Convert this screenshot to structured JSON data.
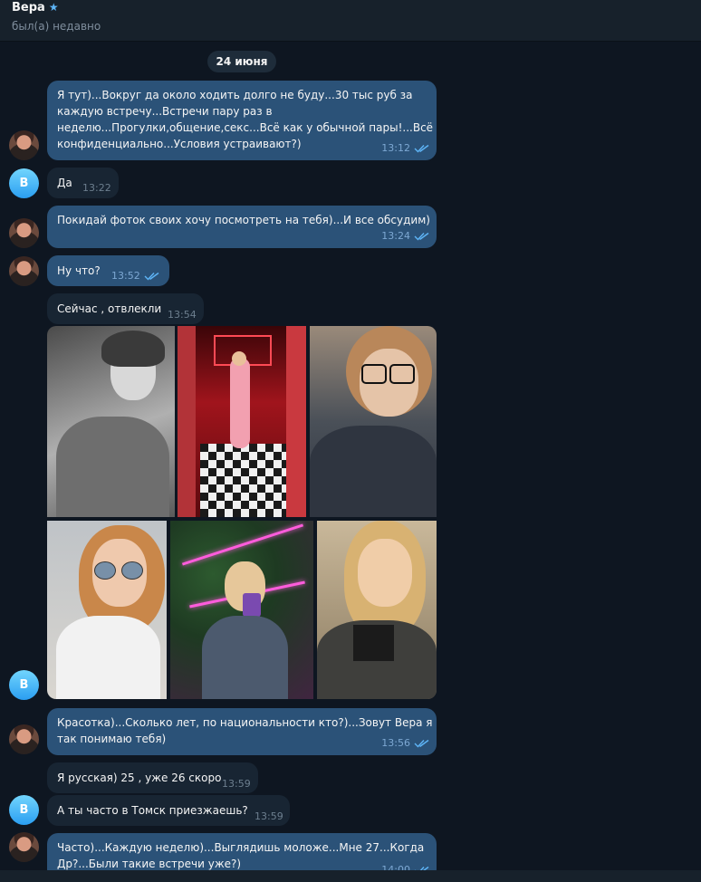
{
  "header": {
    "name": "Вера",
    "status": "был(а) недавно"
  },
  "date_separator": "24 июня",
  "messages": [
    {
      "id": "m1",
      "dir": "out",
      "lines": [
        "Я тут)...Вокруг да около ходить долго не буду...30 тыс руб за",
        "каждую встречу...Встречи пару раз в",
        "неделю...Прогулки,общение,секс...Всё как у обычной пары!...Всё",
        "конфиденциально...Условия устраивают?)"
      ],
      "time": "13:12",
      "read": true
    },
    {
      "id": "m2",
      "dir": "in",
      "lines": [
        "Да"
      ],
      "time": "13:22"
    },
    {
      "id": "m3",
      "dir": "out",
      "lines": [
        "Покидай фоток своих хочу посмотреть на тебя)...И все обсудим)"
      ],
      "time": "13:24",
      "read": true
    },
    {
      "id": "m4",
      "dir": "out",
      "lines": [
        "Ну что?"
      ],
      "time": "13:52",
      "read": true
    },
    {
      "id": "m5",
      "dir": "in",
      "lines": [
        "Сейчас , отвлекли"
      ],
      "time": "13:54"
    },
    {
      "id": "m6",
      "dir": "out",
      "lines": [
        "Красотка)...Сколько лет, по национальности кто?)...Зовут Вера я",
        "так понимаю тебя)"
      ],
      "time": "13:56",
      "read": true
    },
    {
      "id": "m7",
      "dir": "in",
      "lines": [
        "Я русская) 25 , уже 26 скоро"
      ],
      "time": "13:59"
    },
    {
      "id": "m8",
      "dir": "in",
      "lines": [
        "А ты часто в Томск приезжаешь?"
      ],
      "time": "13:59"
    },
    {
      "id": "m9",
      "dir": "out",
      "lines": [
        "Часто)...Каждую неделю)...Выглядишь моложе...Мне 27...Когда",
        "Др?...Были такие встречи уже?)"
      ],
      "time": "14:00",
      "read": true
    }
  ],
  "avatar_letter": "В",
  "photos": [
    {
      "name": "photo-bw-selfie",
      "desc": "black and white selfie"
    },
    {
      "name": "photo-red-room",
      "desc": "red room with checkered floor"
    },
    {
      "name": "photo-glasses-selfie",
      "desc": "selfie with glasses"
    },
    {
      "name": "photo-sunglasses",
      "desc": "selfie in sunglasses"
    },
    {
      "name": "photo-neon-mirror",
      "desc": "neon mirror selfie"
    },
    {
      "name": "photo-warm-selfie",
      "desc": "warm-tone selfie"
    }
  ],
  "colors": {
    "background": "#0e1621",
    "header": "#17212b",
    "outgoing_bubble": "#2b5278",
    "incoming_bubble": "#182533",
    "read_check": "#5eb5f7"
  }
}
